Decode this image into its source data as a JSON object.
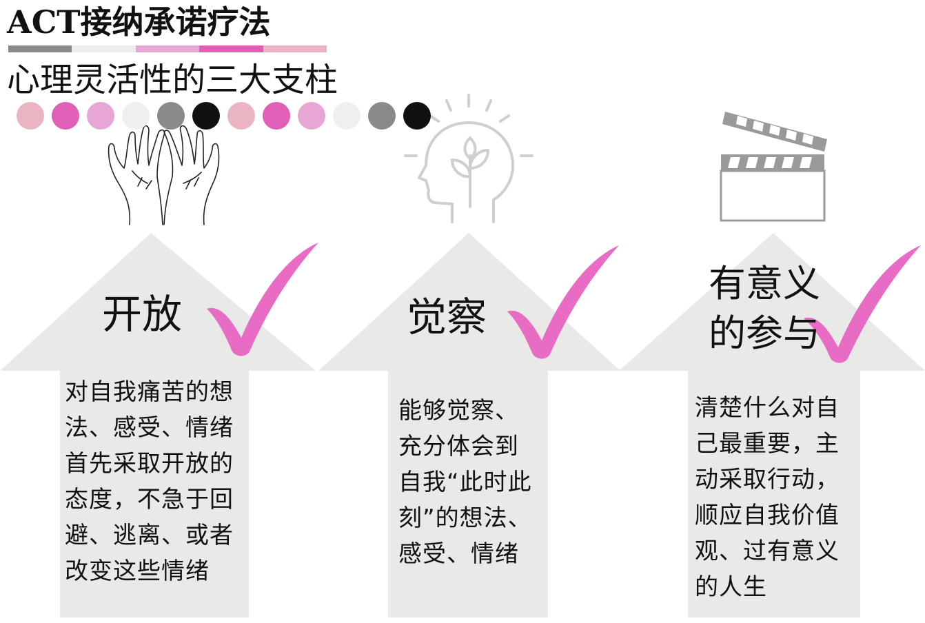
{
  "title": "ACT接纳承诺疗法",
  "title_latin": "ACT",
  "title_cn": "接纳承诺疗法",
  "subtitle": "心理灵活性的三大支柱",
  "colors": {
    "gray": "#8a8a8a",
    "light_gray": "#e6e6e6",
    "pink_light": "#e8a6d5",
    "pink": "#e060b8",
    "pink_pale": "#eeb4c4",
    "black": "#111111",
    "panel": "#e9e9e8",
    "check": "#e86bc4"
  },
  "title_bar_colors": [
    "#8a8a8a",
    "#ececec",
    "#e8a6d5",
    "#e060b8",
    "#eeb4c4"
  ],
  "dot_colors": [
    "#eab4c2",
    "#e060b8",
    "#e8a6d5",
    "#efefef",
    "#8a8a8a",
    "#111111",
    "#eab4c2",
    "#e060b8",
    "#e8a6d5",
    "#efefef",
    "#8a8a8a",
    "#111111"
  ],
  "pillars": [
    {
      "icon": "open-hands-icon",
      "title": "开放",
      "description": [
        "对自我痛苦的想",
        "法、感受、情绪",
        "首先采取开放的",
        "态度，不急于回",
        "避、逃离、或者",
        "改变这些情绪"
      ]
    },
    {
      "icon": "mind-sprout-icon",
      "title": "觉察",
      "description": [
        "能够觉察、",
        "充分体会到",
        "自我“此时此",
        "刻”的想法、",
        "感受、情绪"
      ]
    },
    {
      "icon": "clapperboard-icon",
      "title_lines": [
        "有意义",
        "的参与"
      ],
      "description": [
        "清楚什么对自",
        "己最重要，主",
        "动采取行动，",
        "顺应自我价值",
        "观、过有意义",
        "的人生"
      ]
    }
  ]
}
